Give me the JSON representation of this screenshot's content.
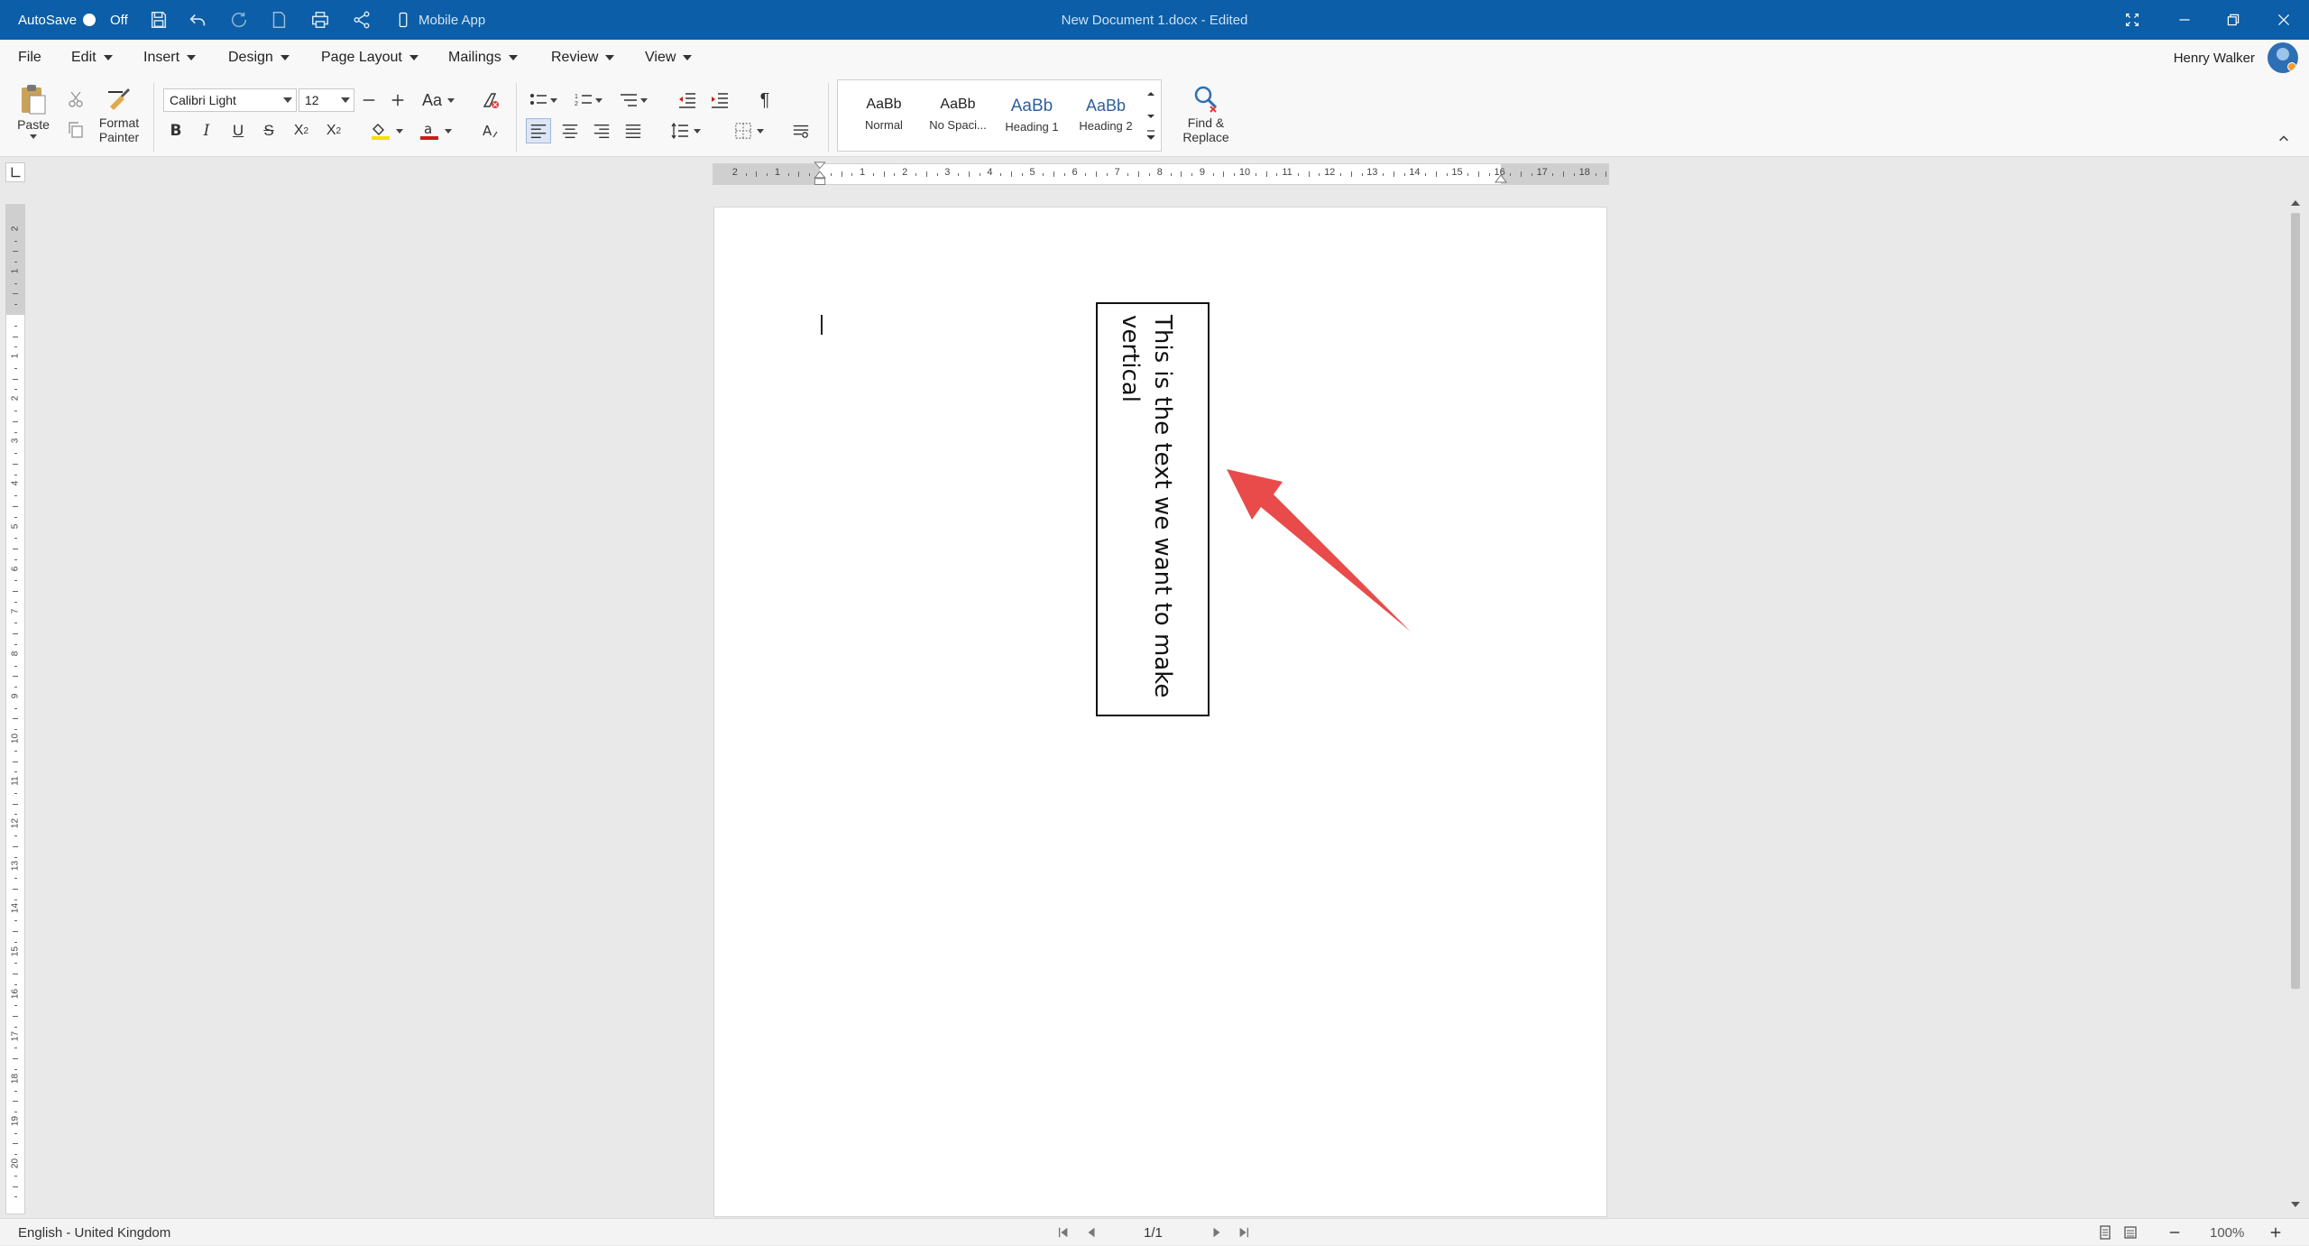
{
  "titlebar": {
    "autosave_label": "AutoSave",
    "autosave_state": "Off",
    "mobile_app_label": "Mobile App",
    "document_title": "New Document 1.docx - Edited"
  },
  "menu": {
    "items": [
      "File",
      "Edit",
      "Insert",
      "Design",
      "Page Layout",
      "Mailings",
      "Review",
      "View"
    ]
  },
  "user": {
    "name": "Henry Walker"
  },
  "ribbon": {
    "paste_label": "Paste",
    "format_painter_label": [
      "Format",
      "Painter"
    ],
    "font_name": "Calibri Light",
    "font_size": "12",
    "change_case_label": "Aa",
    "styles": [
      {
        "preview": "AaBb",
        "name": "Normal"
      },
      {
        "preview": "AaBb",
        "name": "No Spaci..."
      },
      {
        "preview": "AaBb",
        "name": "Heading 1"
      },
      {
        "preview": "AaBb",
        "name": "Heading 2"
      }
    ],
    "find_replace_label": [
      "Find &",
      "Replace"
    ]
  },
  "ruler": {
    "ticks": [
      "2",
      "1",
      "1",
      "2",
      "3",
      "4",
      "5",
      "6",
      "7",
      "8",
      "9",
      "10",
      "11",
      "12",
      "13",
      "14",
      "15",
      "16",
      "17",
      "18"
    ]
  },
  "document": {
    "textbox_text": "This is the text we want to make vertical",
    "annotation_color": "#e94b4b"
  },
  "statusbar": {
    "language": "English - United Kingdom",
    "page_indicator": "1/1",
    "zoom": "100%"
  },
  "colors": {
    "titlebar_bg": "#0b5ea7",
    "highlight": "#f5e000",
    "font_color": "#d11a1a",
    "heading_blue": "#2f5e9e"
  }
}
